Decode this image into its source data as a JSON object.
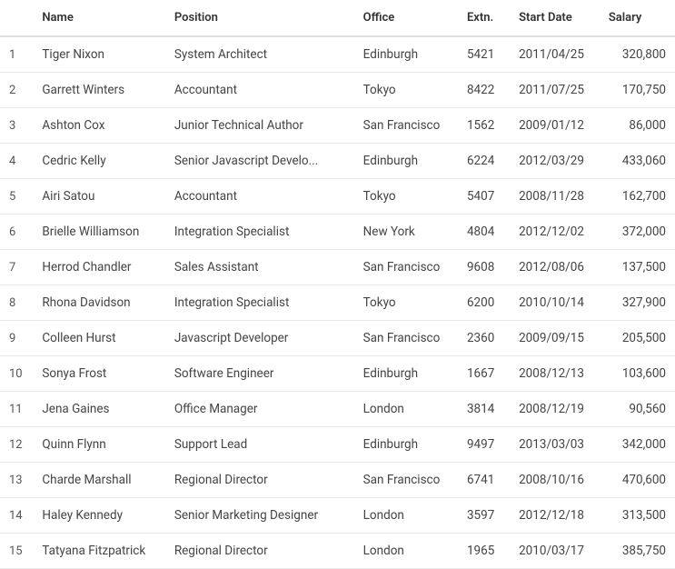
{
  "table": {
    "headers": {
      "num": "",
      "name": "Name",
      "position": "Position",
      "office": "Office",
      "extn": "Extn.",
      "startDate": "Start Date",
      "salary": "Salary"
    },
    "rows": [
      {
        "num": 1,
        "name": "Tiger Nixon",
        "position": "System Architect",
        "office": "Edinburgh",
        "extn": "5421",
        "startDate": "2011/04/25",
        "salary": "320,800"
      },
      {
        "num": 2,
        "name": "Garrett Winters",
        "position": "Accountant",
        "office": "Tokyo",
        "extn": "8422",
        "startDate": "2011/07/25",
        "salary": "170,750"
      },
      {
        "num": 3,
        "name": "Ashton Cox",
        "position": "Junior Technical Author",
        "office": "San Francisco",
        "extn": "1562",
        "startDate": "2009/01/12",
        "salary": "86,000"
      },
      {
        "num": 4,
        "name": "Cedric Kelly",
        "position": "Senior Javascript Develo...",
        "office": "Edinburgh",
        "extn": "6224",
        "startDate": "2012/03/29",
        "salary": "433,060"
      },
      {
        "num": 5,
        "name": "Airi Satou",
        "position": "Accountant",
        "office": "Tokyo",
        "extn": "5407",
        "startDate": "2008/11/28",
        "salary": "162,700"
      },
      {
        "num": 6,
        "name": "Brielle Williamson",
        "position": "Integration Specialist",
        "office": "New York",
        "extn": "4804",
        "startDate": "2012/12/02",
        "salary": "372,000"
      },
      {
        "num": 7,
        "name": "Herrod Chandler",
        "position": "Sales Assistant",
        "office": "San Francisco",
        "extn": "9608",
        "startDate": "2012/08/06",
        "salary": "137,500"
      },
      {
        "num": 8,
        "name": "Rhona Davidson",
        "position": "Integration Specialist",
        "office": "Tokyo",
        "extn": "6200",
        "startDate": "2010/10/14",
        "salary": "327,900"
      },
      {
        "num": 9,
        "name": "Colleen Hurst",
        "position": "Javascript Developer",
        "office": "San Francisco",
        "extn": "2360",
        "startDate": "2009/09/15",
        "salary": "205,500"
      },
      {
        "num": 10,
        "name": "Sonya Frost",
        "position": "Software Engineer",
        "office": "Edinburgh",
        "extn": "1667",
        "startDate": "2008/12/13",
        "salary": "103,600"
      },
      {
        "num": 11,
        "name": "Jena Gaines",
        "position": "Office Manager",
        "office": "London",
        "extn": "3814",
        "startDate": "2008/12/19",
        "salary": "90,560"
      },
      {
        "num": 12,
        "name": "Quinn Flynn",
        "position": "Support Lead",
        "office": "Edinburgh",
        "extn": "9497",
        "startDate": "2013/03/03",
        "salary": "342,000"
      },
      {
        "num": 13,
        "name": "Charde Marshall",
        "position": "Regional Director",
        "office": "San Francisco",
        "extn": "6741",
        "startDate": "2008/10/16",
        "salary": "470,600"
      },
      {
        "num": 14,
        "name": "Haley Kennedy",
        "position": "Senior Marketing Designer",
        "office": "London",
        "extn": "3597",
        "startDate": "2012/12/18",
        "salary": "313,500"
      },
      {
        "num": 15,
        "name": "Tatyana Fitzpatrick",
        "position": "Regional Director",
        "office": "London",
        "extn": "1965",
        "startDate": "2010/03/17",
        "salary": "385,750"
      }
    ]
  }
}
